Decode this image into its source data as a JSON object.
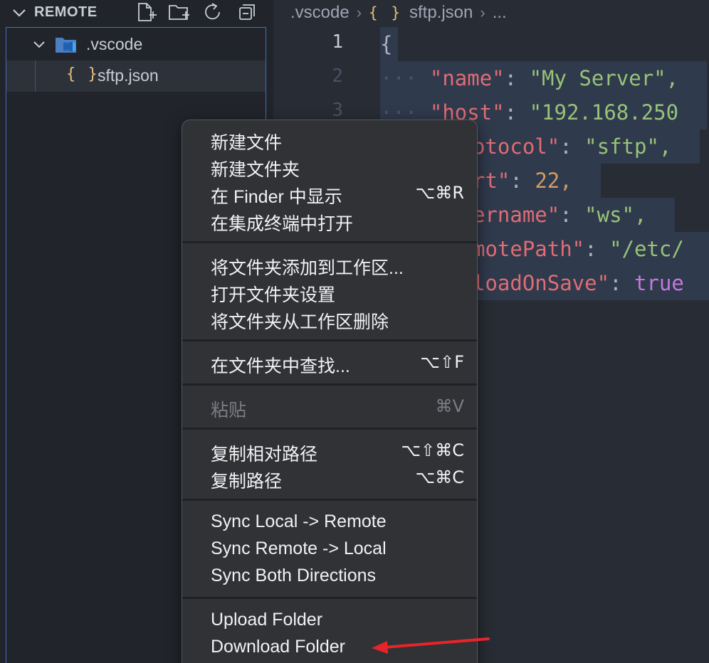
{
  "sidebar": {
    "section_title": "REMOTE",
    "icons": [
      "new-file-icon",
      "new-folder-icon",
      "refresh-icon",
      "collapse-all-icon"
    ],
    "tree": [
      {
        "label": ".vscode",
        "icon": "vscode-folder-icon",
        "expanded": true
      },
      {
        "label": "sftp.json",
        "icon_text": "{ }"
      }
    ]
  },
  "editor": {
    "breadcrumb": {
      "folder": ".vscode",
      "json_icon": "{ }",
      "file": "sftp.json",
      "more": "..."
    },
    "line_numbers": [
      "1",
      "2",
      "3"
    ],
    "code": {
      "l1": "{",
      "l2_key": "\"name\"",
      "l2_val": "\"My Server\",",
      "l3_key": "\"host\"",
      "l3_val": "\"192.168.250",
      "l4_key": "otocol\"",
      "l4_val": "\"sftp\",",
      "l5_key": "rt\"",
      "l5_val": "22,",
      "l6_key": "ername\"",
      "l6_val": "\"ws\",",
      "l7_key": "motePath\"",
      "l7_val": "\"/etc/",
      "l8_key": "loadOnSave\"",
      "l8_val": "true",
      "colon": ":",
      "indent": "···"
    }
  },
  "menu": {
    "groups": [
      [
        {
          "label": "新建文件",
          "shortcut": ""
        },
        {
          "label": "新建文件夹",
          "shortcut": ""
        },
        {
          "label": "在 Finder 中显示",
          "shortcut": "⌥⌘R"
        },
        {
          "label": "在集成终端中打开",
          "shortcut": ""
        }
      ],
      [
        {
          "label": "将文件夹添加到工作区...",
          "shortcut": ""
        },
        {
          "label": "打开文件夹设置",
          "shortcut": ""
        },
        {
          "label": "将文件夹从工作区删除",
          "shortcut": ""
        }
      ],
      [
        {
          "label": "在文件夹中查找...",
          "shortcut": "⌥⇧F"
        }
      ],
      [
        {
          "label": "粘贴",
          "shortcut": "⌘V",
          "disabled": true
        }
      ],
      [
        {
          "label": "复制相对路径",
          "shortcut": "⌥⇧⌘C"
        },
        {
          "label": "复制路径",
          "shortcut": "⌥⌘C"
        }
      ],
      [
        {
          "label": "Sync Local -> Remote",
          "shortcut": ""
        },
        {
          "label": "Sync Remote -> Local",
          "shortcut": ""
        },
        {
          "label": "Sync Both Directions",
          "shortcut": ""
        }
      ],
      [
        {
          "label": "Upload Folder",
          "shortcut": ""
        },
        {
          "label": "Download Folder",
          "shortcut": ""
        }
      ]
    ]
  },
  "annotation": {
    "arrow_color": "#e8242b",
    "points_to": "Download Folder"
  },
  "colors": {
    "sidebar_bg": "#21252b",
    "editor_bg": "#282c34",
    "menu_bg": "#303236",
    "focus_border": "#3e6fb8",
    "json_icon": "#e5c07b"
  }
}
